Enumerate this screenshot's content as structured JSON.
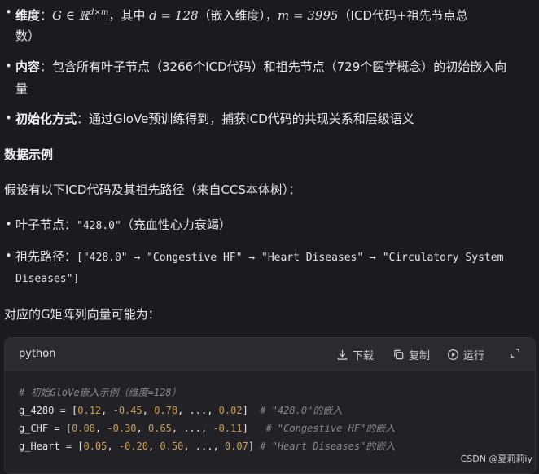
{
  "dim_item": {
    "bullet": "•",
    "label": "维度",
    "colon": "：",
    "math1": "G ∈ ℝ",
    "sup": "d×m",
    "text1": "，其中 ",
    "math2": "d = 128",
    "text2": "（嵌入维度），",
    "math3": "m = 3995",
    "text3": "（ICD代码+祖先节点总",
    "cont": "数）"
  },
  "content_item": {
    "bullet": "•",
    "label": "内容",
    "text": "：包含所有叶子节点（3266个ICD代码）和祖先节点（729个医学概念）的初始嵌入向",
    "cont": "量"
  },
  "init_item": {
    "bullet": "•",
    "label": "初始化方式",
    "text": "：通过GloVe预训练得到，捕获ICD代码的共现关系和层级语义"
  },
  "section_title": "数据示例",
  "intro_text": "假设有以下ICD代码及其祖先路径（来自CCS本体树）：",
  "leaf_item": {
    "bullet": "•",
    "label": "叶子节点：",
    "code": "\"428.0\"",
    "text": "（充血性心力衰竭）"
  },
  "path_item": {
    "bullet": "•",
    "label": "祖先路径：",
    "code": "[\"428.0\" → \"Congestive HF\" → \"Heart Diseases\" → \"Circulatory System",
    "cont": "Diseases\"]"
  },
  "matrix_text": "对应的G矩阵列向量可能为：",
  "codeblock": {
    "language": "python",
    "download_label": "下载",
    "copy_label": "复制",
    "run_label": "运行",
    "comment": "# 初始GloVe嵌入示例（维度=128）",
    "rows": [
      {
        "name": "g_4280 = [",
        "v1": "0.12",
        "s1": ", ",
        "v2": "-0.45",
        "s2": ", ",
        "v3": "0.78",
        "s3": ", ..., ",
        "v4": "0.02",
        "end": "]  ",
        "comment": "# \"428.0\"的嵌入"
      },
      {
        "name": "g_CHF = [",
        "v1": "0.08",
        "s1": ", ",
        "v2": "-0.30",
        "s2": ", ",
        "v3": "0.65",
        "s3": ", ..., ",
        "v4": "-0.11",
        "end": "]   ",
        "comment": "# \"Congestive HF\"的嵌入"
      },
      {
        "name": "g_Heart = [",
        "v1": "0.05",
        "s1": ", ",
        "v2": "-0.20",
        "s2": ", ",
        "v3": "0.50",
        "s3": ", ..., ",
        "v4": "0.07",
        "end": "] ",
        "comment": "# \"Heart Diseases\"的嵌入"
      }
    ]
  },
  "watermark": "CSDN @夏莉莉iy",
  "colors": {
    "background": "#1b1b1f",
    "code_bg": "#222226",
    "number": "#c8a15a",
    "comment": "#8a8a8a"
  }
}
